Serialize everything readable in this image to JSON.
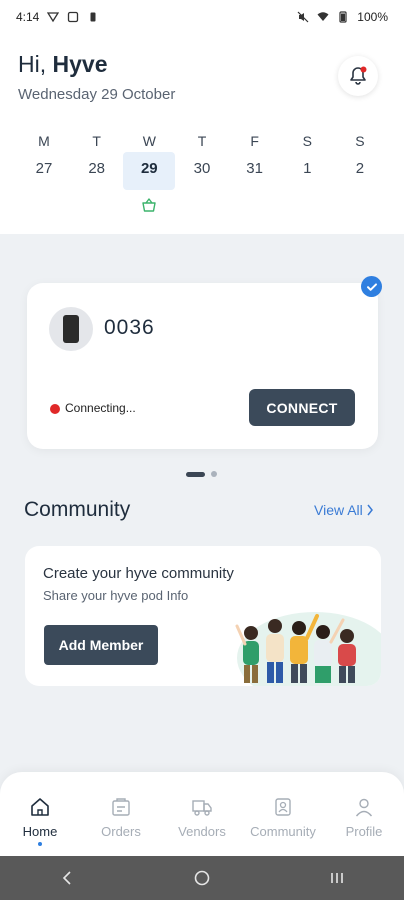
{
  "status_bar": {
    "time": "4:14",
    "battery": "100%"
  },
  "header": {
    "greeting_prefix": "Hi, ",
    "user_name": "Hyve",
    "date": "Wednesday 29 October"
  },
  "week": [
    {
      "name": "M",
      "num": "27"
    },
    {
      "name": "T",
      "num": "28"
    },
    {
      "name": "W",
      "num": "29",
      "selected": true
    },
    {
      "name": "T",
      "num": "30"
    },
    {
      "name": "F",
      "num": "31"
    },
    {
      "name": "S",
      "num": "1"
    },
    {
      "name": "S",
      "num": "2"
    }
  ],
  "device": {
    "name": "0036",
    "status": "Connecting...",
    "status_color": "#e02828",
    "connect_label": "CONNECT"
  },
  "community": {
    "title": "Community",
    "view_all": "View All",
    "card_title": "Create your hyve community",
    "card_subtitle": "Share your hyve pod Info",
    "add_member_label": "Add Member"
  },
  "nav": {
    "items": [
      {
        "label": "Home",
        "icon": "home-icon"
      },
      {
        "label": "Orders",
        "icon": "orders-icon"
      },
      {
        "label": "Vendors",
        "icon": "truck-icon"
      },
      {
        "label": "Community",
        "icon": "community-icon"
      },
      {
        "label": "Profile",
        "icon": "profile-icon"
      }
    ]
  },
  "colors": {
    "accent": "#2f7fe0",
    "button_dark": "#3b4a5a",
    "basket": "#3bb36b"
  }
}
